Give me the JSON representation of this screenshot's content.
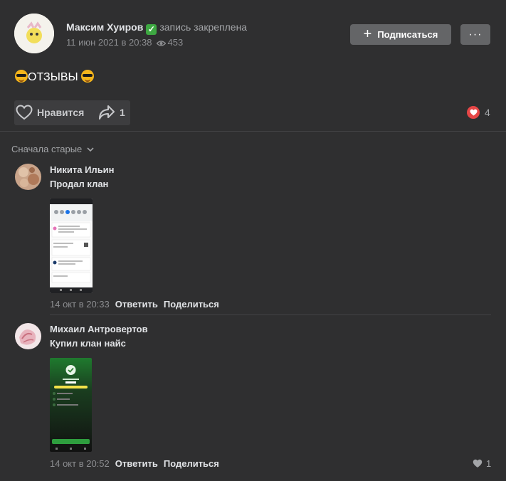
{
  "post": {
    "author": "Максим Хуиров",
    "pinned_label": "запись закреплена",
    "date": "11 июн 2021 в 20:38",
    "views": "453",
    "text": "ОТЗЫВЫ",
    "subscribe_label": "Подписаться",
    "more_label": "···",
    "like_label": "Нравится",
    "share_count": "1",
    "reaction_count": "4",
    "sort_label": "Сначала старые"
  },
  "comments": [
    {
      "author": "Никита Ильин",
      "text": "Продал клан",
      "date": "14 окт в 20:33",
      "reply_label": "Ответить",
      "share_label": "Поделиться"
    },
    {
      "author": "Михаил Антровертов",
      "text": "Купил клан найс",
      "date": "14 окт в 20:52",
      "reply_label": "Ответить",
      "share_label": "Поделиться",
      "likes": "1"
    }
  ],
  "colors": {
    "background": "#2f2f30",
    "button": "#646567",
    "reaction": "#e64646",
    "verified": "#3ea842"
  }
}
